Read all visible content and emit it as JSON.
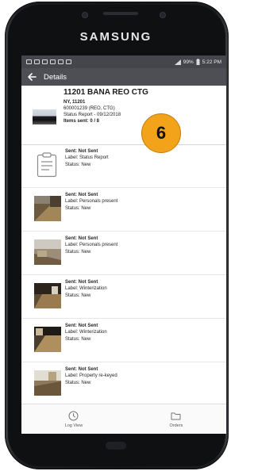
{
  "device": {
    "brand": "SAMSUNG"
  },
  "status_bar": {
    "battery": "99%",
    "time": "5:22 PM"
  },
  "app_bar": {
    "title": "Details"
  },
  "header": {
    "title": "11201 BANA REO CTG",
    "location": "NY, 11201",
    "order_id": "600001239 (REO, CTG)",
    "report": "Status Report - 09/12/2018",
    "items_sent": "Items sent: 0 / 8"
  },
  "items": [
    {
      "sent": "Sent: Not Sent",
      "label": "Label: Status Report",
      "status": "Status: New",
      "icon": "clipboard-icon"
    },
    {
      "sent": "Sent: Not Sent",
      "label": "Label: Personals present",
      "status": "Status: New",
      "icon": "photo-thumbnail"
    },
    {
      "sent": "Sent: Not Sent",
      "label": "Label: Personals present",
      "status": "Status: New",
      "icon": "photo-thumbnail"
    },
    {
      "sent": "Sent: Not Sent",
      "label": "Label: Winterization",
      "status": "Status: New",
      "icon": "photo-thumbnail"
    },
    {
      "sent": "Sent: Not Sent",
      "label": "Label: Winterization",
      "status": "Status: New",
      "icon": "photo-thumbnail"
    },
    {
      "sent": "Sent: Not Sent",
      "label": "Label: Property re-keyed",
      "status": "Status: New",
      "icon": "photo-thumbnail"
    }
  ],
  "step_badge": "6",
  "bottom_nav": {
    "log_view": {
      "label": "Log View",
      "icon": "clock-icon"
    },
    "orders": {
      "label": "Orders",
      "icon": "folder-icon"
    }
  },
  "colors": {
    "app_bar": "#4d4f55",
    "status_bar": "#44464b",
    "badge": "#f2a31a"
  }
}
